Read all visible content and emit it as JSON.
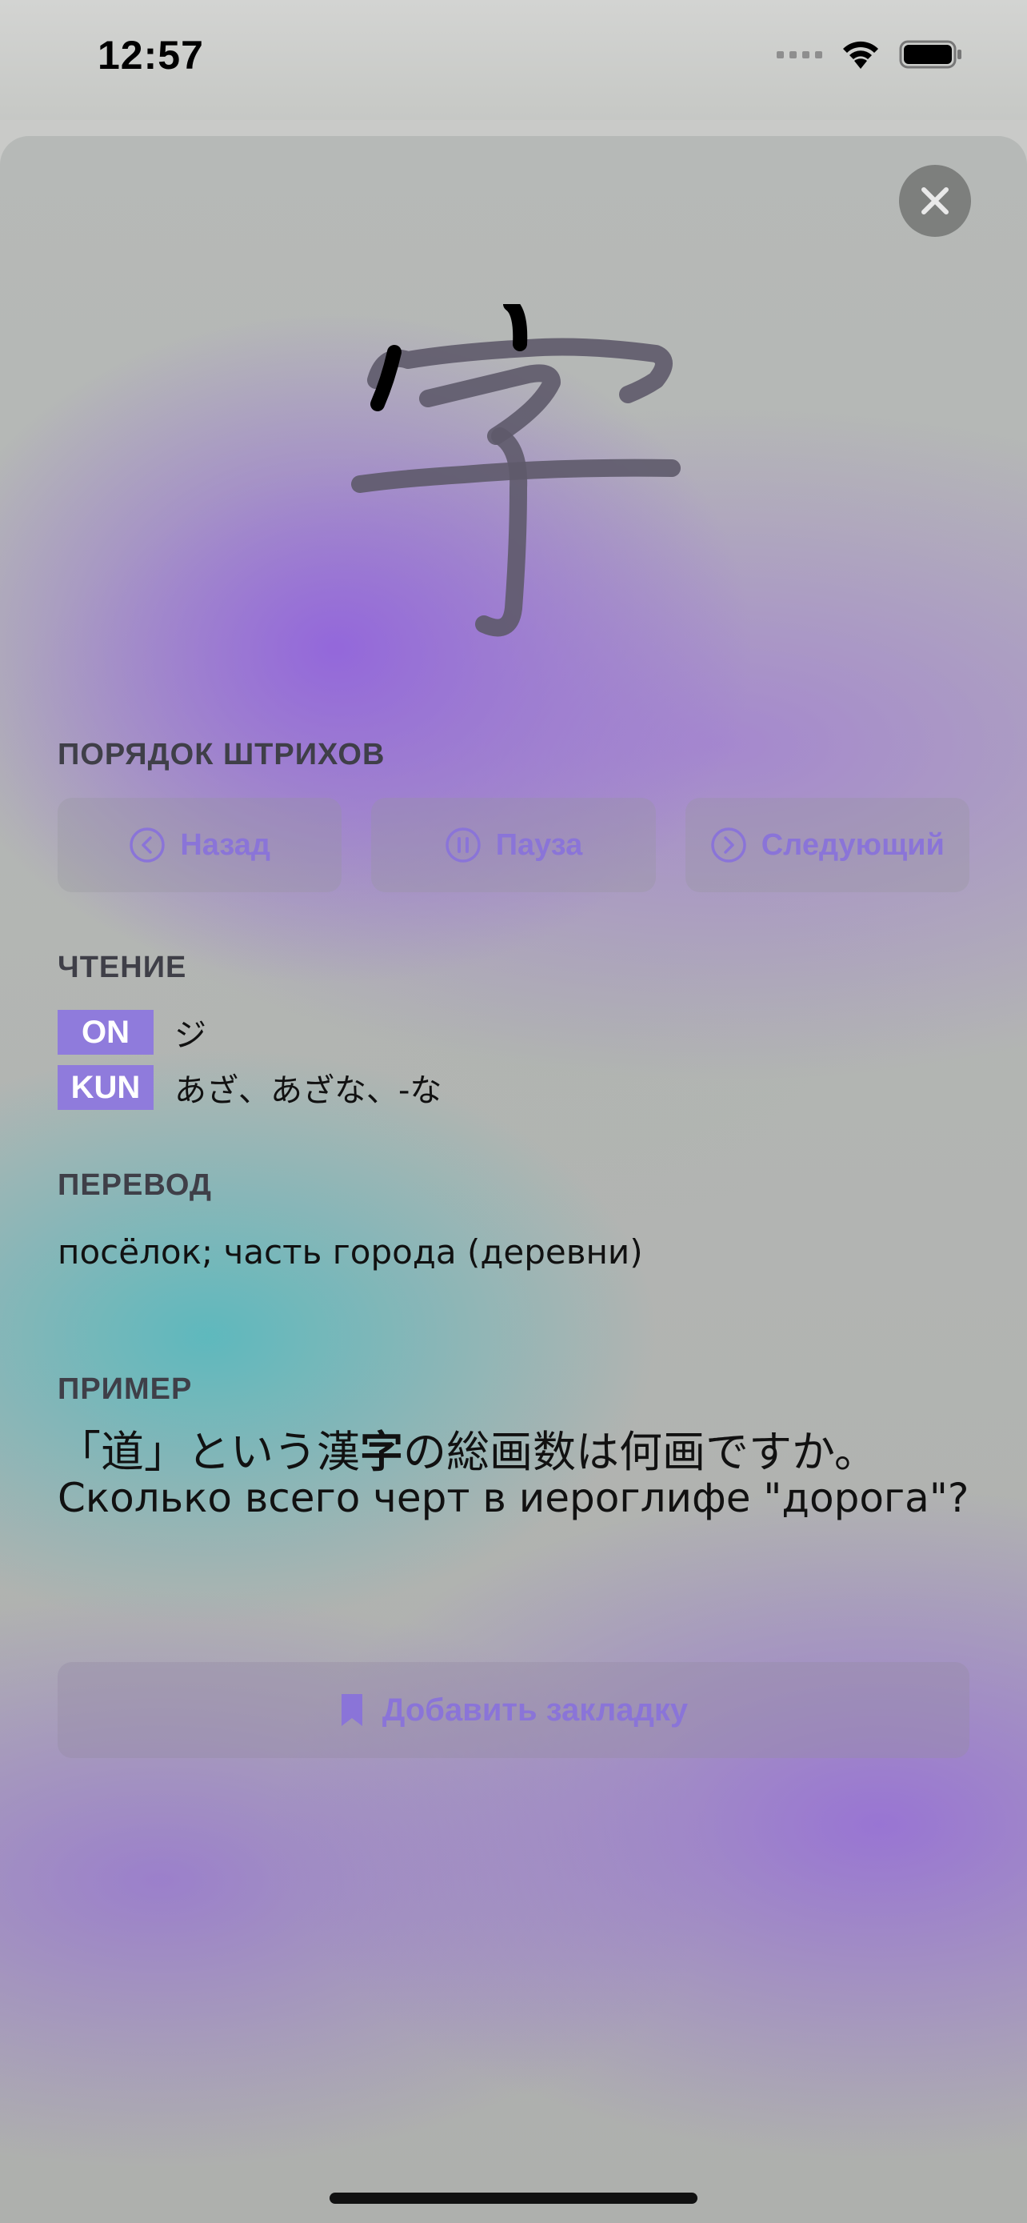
{
  "status_bar": {
    "time": "12:57"
  },
  "kanji": {
    "character": "字"
  },
  "stroke_order": {
    "label": "ПОРЯДОК ШТРИХОВ",
    "back_label": "Назад",
    "pause_label": "Пауза",
    "next_label": "Следующий"
  },
  "reading": {
    "label": "ЧТЕНИЕ",
    "on_badge": "ON",
    "on_text": "ジ",
    "kun_badge": "KUN",
    "kun_text": "あざ、あざな、-な"
  },
  "translation": {
    "label": "ПЕРЕВОД",
    "text": "посёлок; часть города (деревни)"
  },
  "example": {
    "label": "ПРИМЕР",
    "jp_before": "「道」という漢",
    "jp_highlight": "字",
    "jp_after": "の総画数は何画ですか。",
    "ru": "Сколько всего черт в иероглифе \"дорога\"?"
  },
  "bookmark": {
    "label": "Добавить закладку"
  },
  "colors": {
    "accent": "#8a74d8",
    "badge": "#8f7bdc"
  }
}
